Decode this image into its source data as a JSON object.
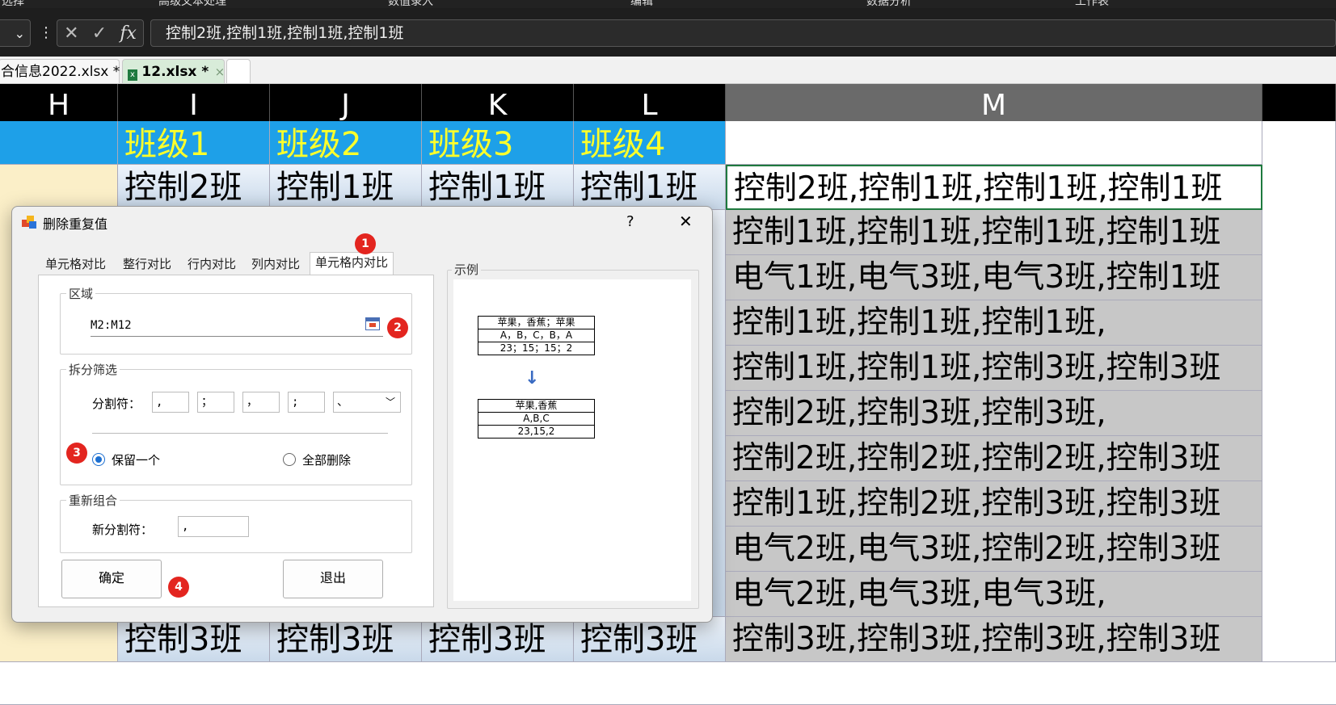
{
  "ribbon": {
    "labels": [
      "选择",
      "高级文本处理",
      "数值录入",
      "编辑",
      "数据分析",
      "工作表"
    ]
  },
  "formula_bar": {
    "fx": "fx",
    "value": "控制2班,控制1班,控制1班,控制1班"
  },
  "workbook_tabs": [
    {
      "label": "合信息2022.xlsx *"
    },
    {
      "label": "12.xlsx *",
      "close": "×"
    }
  ],
  "columns": [
    "H",
    "I",
    "J",
    "K",
    "L",
    "M"
  ],
  "header_row": [
    "",
    "班级1",
    "班级2",
    "班级3",
    "班级4",
    ""
  ],
  "rows": [
    {
      "I": "控制2班",
      "J": "控制1班",
      "K": "控制1班",
      "L": "控制1班",
      "M": "控制2班,控制1班,控制1班,控制1班"
    },
    {
      "M": "控制1班,控制1班,控制1班,控制1班"
    },
    {
      "M": "电气1班,电气3班,电气3班,控制1班"
    },
    {
      "M": "控制1班,控制1班,控制1班,"
    },
    {
      "M": "控制1班,控制1班,控制3班,控制3班"
    },
    {
      "M": "控制2班,控制3班,控制3班,"
    },
    {
      "M": "控制2班,控制2班,控制2班,控制3班"
    },
    {
      "M": "控制1班,控制2班,控制3班,控制3班"
    },
    {
      "M": "电气2班,电气3班,控制2班,控制3班"
    },
    {
      "M": "电气2班,电气3班,电气3班,"
    },
    {
      "I": "控制3班",
      "J": "控制3班",
      "K": "控制3班",
      "L": "控制3班",
      "M": "控制3班,控制3班,控制3班,控制3班"
    }
  ],
  "dialog": {
    "title": "删除重复值",
    "help": "?",
    "close": "✕",
    "tabs": [
      "单元格对比",
      "整行对比",
      "行内对比",
      "列内对比",
      "单元格内对比"
    ],
    "active_tab": "单元格内对比",
    "area_group": {
      "label": "区域",
      "range": "M2:M12"
    },
    "split_group": {
      "label": "拆分筛选",
      "delimiter_label": "分割符：",
      "delimiters": [
        ",",
        "；",
        "，",
        ";"
      ],
      "dropdown_value": "、",
      "options": [
        {
          "label": "保留一个",
          "checked": true
        },
        {
          "label": "全部删除",
          "checked": false
        }
      ]
    },
    "recombine_group": {
      "label": "重新组合",
      "new_delimiter_label": "新分割符：",
      "new_delimiter": ","
    },
    "ok_button": "确定",
    "exit_button": "退出",
    "example": {
      "label": "示例",
      "before": [
        "苹果，香蕉；苹果",
        "A，B，C，B，A",
        "23；15；15；2"
      ],
      "arrow": "↓",
      "after": [
        "苹果,香蕉",
        "A,B,C",
        "23,15,2"
      ]
    },
    "badges": [
      "1",
      "2",
      "3",
      "4"
    ]
  },
  "colors": {
    "header_fill": "#1ea0e8",
    "header_text": "#ffff2a",
    "selected_border": "#1f7a3f",
    "badge": "#e3251f"
  }
}
